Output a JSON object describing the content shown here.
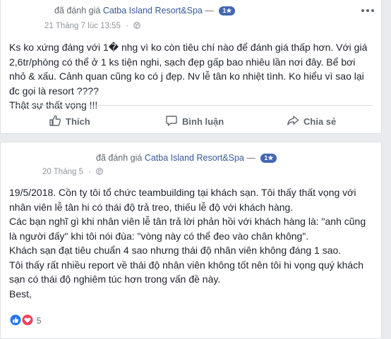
{
  "posts": [
    {
      "header": {
        "action_text": "đã đánh giá",
        "page_name": "Catba Island Resort&Spa",
        "separator": "—",
        "badge": "1★",
        "timestamp": "21 Tháng 7 lúc 13:55",
        "dot": "·"
      },
      "body": [
        "Ks ko xứng đáng với 1� nhg vì ko còn tiêu chí nào để đánh giá thấp hơn. Với giá 2,6tr/phòng có thể ở 1 ks tiện nghi, sạch đẹp gấp bao nhiêu lần nơi đây. Bể bơi nhỏ & xấu. Cảnh quan cũng ko có j đẹp. Nv lễ tân ko nhiệt tình. Ko hiểu vì sao lại đc gọi là resort ????",
        "Thật sự thất vọng !!!"
      ],
      "actions": {
        "like": "Thích",
        "comment": "Bình luận",
        "share": "Chia sẻ"
      }
    },
    {
      "header": {
        "action_text": "đã đánh giá",
        "page_name": "Catba Island Resort&Spa",
        "separator": "—",
        "badge": "1★",
        "timestamp": "20 Tháng 5",
        "dot": "·"
      },
      "body": [
        "19/5/2018. Cồn ty tôi tổ chức teambuilding tại khách sạn. Tôi thấy thất vọng với nhân viên lễ tân hi có thái độ trả treo, thiếu lễ độ với khách hàng.",
        "Các bạn nghĩ gì khi nhân viên lễ tân trả lời phản hồi với khách hàng là: \"anh cũng là người đấy\" khi tôi nói đùa: \"vòng này có thể đeo vào chân không\".",
        "Khách sạn đạt tiêu chuẩn 4 sao nhưng thái độ nhân viên không đáng 1 sao.",
        "Tôi thấy rất nhiều report về thái độ nhân viên không tốt nên tôi hi vọng quý khách sạn có thái độ nghiêm túc hơn trong vấn đề này.",
        "Best,"
      ],
      "reactions": {
        "count": "5"
      }
    }
  ],
  "colors": {
    "link": "#365899",
    "badge": "#4267b2",
    "like_blue": "#2078f4",
    "love_red": "#f33e58"
  }
}
